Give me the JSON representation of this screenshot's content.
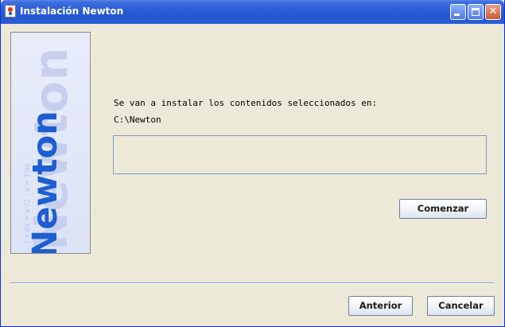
{
  "window": {
    "title": "Instalación Newton",
    "icon": "java-cup-icon",
    "controls": {
      "minimize": "minimize-icon",
      "maximize": "maximize-icon",
      "close": "close-icon",
      "close_glyph": "✕"
    }
  },
  "side_image": {
    "logo_text": "Newton",
    "watermark_text": "Newton",
    "formula_text": "∫ x dx = x²/2 · a = F/m"
  },
  "install": {
    "message": "Se van a instalar los contenidos seleccionados en:",
    "path": "C:\\Newton",
    "progress": 0
  },
  "buttons": {
    "start": "Comenzar",
    "previous": "Anterior",
    "cancel": "Cancelar"
  },
  "colors": {
    "titlebar": "#2457d0",
    "background": "#ece9d8",
    "logo_blue": "#1d5fd1"
  }
}
